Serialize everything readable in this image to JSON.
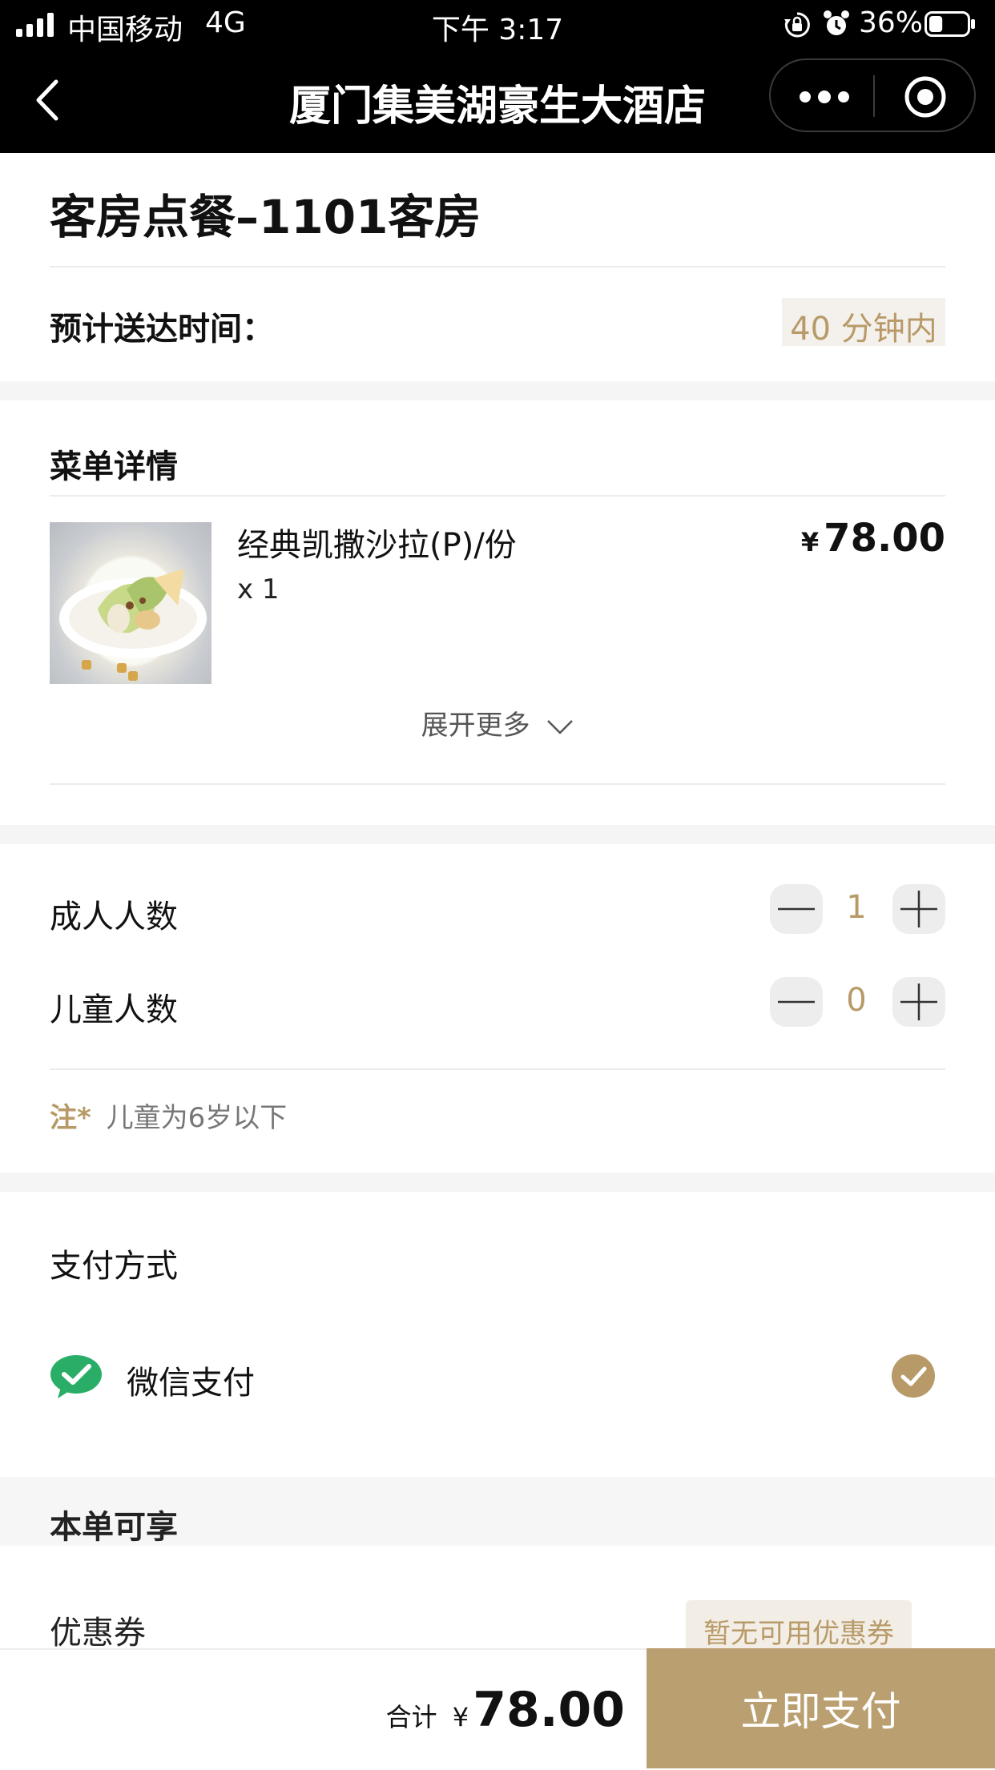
{
  "status_bar": {
    "carrier": "中国移动",
    "network": "4G",
    "time": "下午 3:17",
    "battery": "36%",
    "battery_level": 0.36
  },
  "nav": {
    "title": "厦门集美湖豪生大酒店"
  },
  "order": {
    "heading": "客房点餐–1101客房",
    "eta_label": "预计送达时间：",
    "eta_value": "40 分钟内"
  },
  "menu": {
    "section_title": "菜单详情",
    "items": [
      {
        "name": "经典凯撒沙拉(P)/份",
        "qty": "x 1",
        "price_symbol": "¥",
        "price": "78.00"
      }
    ],
    "expand_label": "展开更多"
  },
  "guests": {
    "adults_label": "成人人数",
    "adults_value": "1",
    "children_label": "儿童人数",
    "children_value": "0",
    "note_prefix": "注*",
    "note_text": "儿童为6岁以下"
  },
  "payment": {
    "section_title": "支付方式",
    "method_label": "微信支付"
  },
  "discount": {
    "section_title": "本单可享",
    "coupon_label": "优惠券",
    "coupon_value": "暂无可用优惠券"
  },
  "footer": {
    "total_label": "合计",
    "currency": "¥",
    "total": "78.00",
    "pay_button": "立即支付"
  },
  "colors": {
    "accent_gold": "#baa070",
    "wechat_green": "#2aae67",
    "topbar": "#000000"
  }
}
